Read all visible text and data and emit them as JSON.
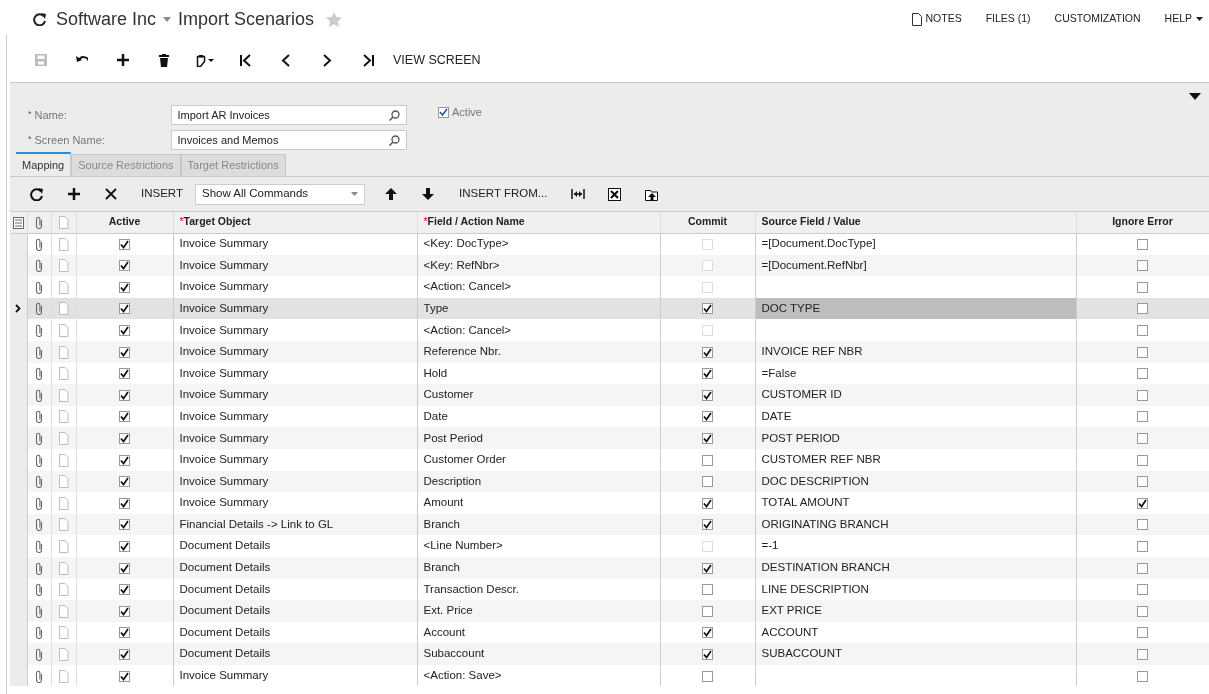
{
  "header": {
    "breadcrumb": "Software Inc",
    "title": "Import Scenarios",
    "favorite": false,
    "links": [
      {
        "label": "NOTES",
        "kind": "notes"
      },
      {
        "label": "FILES (1)",
        "kind": "plain"
      },
      {
        "label": "CUSTOMIZATION",
        "kind": "plain"
      },
      {
        "label": "HELP",
        "kind": "menu"
      }
    ]
  },
  "toolbar": {
    "buttons": [
      {
        "kind": "save",
        "disabled": true
      },
      {
        "kind": "undo",
        "disabled": false
      },
      {
        "kind": "add",
        "disabled": false
      },
      {
        "kind": "delete",
        "disabled": false
      },
      {
        "kind": "paste",
        "disabled": false
      },
      {
        "kind": "first",
        "disabled": false
      },
      {
        "kind": "prev",
        "disabled": false
      },
      {
        "kind": "next",
        "disabled": false
      },
      {
        "kind": "last",
        "disabled": false
      }
    ],
    "text_button": "VIEW SCREEN"
  },
  "form": {
    "fields": [
      {
        "mark": "*",
        "label": "Name:",
        "value": "Import AR Invoices"
      },
      {
        "mark": "*",
        "label": "Screen Name:",
        "value": "Invoices and Memos"
      }
    ],
    "active": {
      "label": "Active",
      "checked": true
    }
  },
  "tabs": [
    {
      "label": "Mapping",
      "selected": true
    },
    {
      "label": "Source Restrictions",
      "selected": false
    },
    {
      "label": "Target Restrictions",
      "selected": false
    }
  ],
  "grid_toolbar": {
    "items": [
      {
        "kind": "refresh"
      },
      {
        "kind": "add"
      },
      {
        "kind": "remove"
      },
      {
        "kind": "text",
        "label": "INSERT"
      },
      {
        "kind": "select",
        "label": "Show All Commands"
      },
      {
        "kind": "up"
      },
      {
        "kind": "down"
      },
      {
        "kind": "text",
        "label": "INSERT FROM..."
      },
      {
        "kind": "fit"
      },
      {
        "kind": "excel"
      },
      {
        "kind": "upload"
      }
    ]
  },
  "table": {
    "columns": [
      {
        "label": "Active"
      },
      {
        "label": "Target Object",
        "mark": "*"
      },
      {
        "label": "Field / Action Name",
        "mark": "*"
      },
      {
        "label": "Commit"
      },
      {
        "label": "Source Field / Value"
      },
      {
        "label": "Ignore Error"
      }
    ],
    "rows": [
      {
        "selected": false,
        "active": true,
        "target": "Invoice Summary",
        "field": "<Key: DocType>",
        "commit": false,
        "commit_disabled": true,
        "source": "=[Document.DocType]",
        "ignore_error": false
      },
      {
        "selected": false,
        "active": true,
        "target": "Invoice Summary",
        "field": "<Key: RefNbr>",
        "commit": false,
        "commit_disabled": true,
        "source": "=[Document.RefNbr]",
        "ignore_error": false
      },
      {
        "selected": false,
        "active": true,
        "target": "Invoice Summary",
        "field": "<Action: Cancel>",
        "commit": false,
        "commit_disabled": true,
        "ignore_error": false
      },
      {
        "selected": true,
        "active": true,
        "target": "Invoice Summary",
        "field": "Type",
        "commit": true,
        "commit_disabled": false,
        "source": "DOC TYPE",
        "ignore_error": false
      },
      {
        "selected": false,
        "active": true,
        "target": "Invoice Summary",
        "field": "<Action: Cancel>",
        "commit": false,
        "commit_disabled": true,
        "ignore_error": false
      },
      {
        "selected": false,
        "active": true,
        "target": "Invoice Summary",
        "field": "Reference Nbr.",
        "commit": true,
        "commit_disabled": false,
        "source": "INVOICE REF NBR",
        "ignore_error": false
      },
      {
        "selected": false,
        "active": true,
        "target": "Invoice Summary",
        "field": "Hold",
        "commit": true,
        "commit_disabled": false,
        "source": "=False",
        "ignore_error": false
      },
      {
        "selected": false,
        "active": true,
        "target": "Invoice Summary",
        "field": "Customer",
        "commit": true,
        "commit_disabled": false,
        "source": "CUSTOMER ID",
        "ignore_error": false
      },
      {
        "selected": false,
        "active": true,
        "target": "Invoice Summary",
        "field": "Date",
        "commit": true,
        "commit_disabled": false,
        "source": "DATE",
        "ignore_error": false
      },
      {
        "selected": false,
        "active": true,
        "target": "Invoice Summary",
        "field": "Post Period",
        "commit": true,
        "commit_disabled": false,
        "source": "POST PERIOD",
        "ignore_error": false
      },
      {
        "selected": false,
        "active": true,
        "target": "Invoice Summary",
        "field": "Customer Order",
        "commit": false,
        "commit_disabled": false,
        "source": "CUSTOMER REF NBR",
        "ignore_error": false
      },
      {
        "selected": false,
        "active": true,
        "target": "Invoice Summary",
        "field": "Description",
        "commit": false,
        "commit_disabled": false,
        "source": "DOC DESCRIPTION",
        "ignore_error": false
      },
      {
        "selected": false,
        "active": true,
        "target": "Invoice Summary",
        "field": "Amount",
        "commit": true,
        "commit_disabled": false,
        "source": "TOTAL AMOUNT",
        "ignore_error": true
      },
      {
        "selected": false,
        "active": true,
        "target": "Financial Details -> Link to GL",
        "field": "Branch",
        "commit": true,
        "commit_disabled": false,
        "source": "ORIGINATING BRANCH",
        "ignore_error": false
      },
      {
        "selected": false,
        "active": true,
        "target": "Document Details",
        "field": "<Line Number>",
        "commit": false,
        "commit_disabled": true,
        "source": "=-1",
        "ignore_error": false
      },
      {
        "selected": false,
        "active": true,
        "target": "Document Details",
        "field": "Branch",
        "commit": true,
        "commit_disabled": false,
        "source": "DESTINATION BRANCH",
        "ignore_error": false
      },
      {
        "selected": false,
        "active": true,
        "target": "Document Details",
        "field": "Transaction Descr.",
        "commit": false,
        "commit_disabled": false,
        "source": "LINE DESCRIPTION",
        "ignore_error": false
      },
      {
        "selected": false,
        "active": true,
        "target": "Document Details",
        "field": "Ext. Price",
        "commit": false,
        "commit_disabled": false,
        "source": "EXT PRICE",
        "ignore_error": false
      },
      {
        "selected": false,
        "active": true,
        "target": "Document Details",
        "field": "Account",
        "commit": true,
        "commit_disabled": false,
        "source": "ACCOUNT",
        "ignore_error": false
      },
      {
        "selected": false,
        "active": true,
        "target": "Document Details",
        "field": "Subaccount",
        "commit": true,
        "commit_disabled": false,
        "source": "SUBACCOUNT",
        "ignore_error": false
      },
      {
        "selected": false,
        "active": true,
        "target": "Invoice Summary",
        "field": "<Action: Save>",
        "commit": false,
        "commit_disabled": false,
        "ignore_error": false
      }
    ]
  }
}
